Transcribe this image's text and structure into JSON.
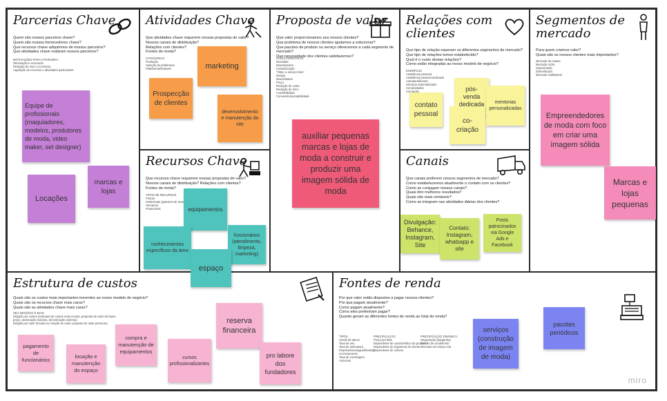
{
  "blocks": {
    "parcerias": {
      "title": "Parcerias Chave",
      "questions": "Quem são nossos parceiros chave?\nQuem são nossos fornecedores chave?\nQue recursos chave adquirimos de nossos parceiros?\nQue atividades chave realizam nossos parceiros?",
      "small": "MOTIVAÇÕES PARA A PARCERIA\nOtimização e economia\nRedução de risco e incerteza\nAquisição de recursos e atividades particulares",
      "notes": [
        "Equipe de profissionais (maquiadores, modelos, produtores de moda, video maker, set designer)",
        "Locações",
        "marcas e lojas"
      ]
    },
    "atividades": {
      "title": "Atividades Chave",
      "questions": "Que atividades chave requerem nossas propostas de valor?\nNossos canais de distribuição?\nRelações com clientes?\nFontes de renda?",
      "small": "CATEGORIAS\nProdução\nSolução de problemas\nPlataforma/Network",
      "notes": [
        "marketing",
        "Prospecção de clientes",
        "desenvolvimento e manutenção do site"
      ]
    },
    "recursos": {
      "title": "Recursos Chave",
      "questions": "Que recursos chave requerem nossas propostas de valor?\nNossos canais de distribuição? Relações com clientes?\nFontes de renda?",
      "small": "TIPOS DE RECURSOS\nFísicos\nIntelectuais (patentes de marcas, direitos autorais, dados)\nHumanos\nFinanceiros",
      "notes": [
        "equipamentos",
        "conhecimentos específicos da área",
        "funcionários (atendimento, limpeza, marketing)",
        "espaço"
      ]
    },
    "proposta": {
      "title": "Proposta de valor",
      "questions": "Que valor proporcionamos aos nossos clientes?\nQue problema de nossos clientes ajudamos a solucionar?\nQue pacotes de produto ou serviço oferecemos a cada segmento de mercado?\nQue necessidade dos clientes satisfazemos?",
      "small": "CARACTERÍSTICAS\nNovidade\nDesempenho\nCustomização\n\"Obter o serviço feito\"\nDesign\nMarca/status\nPreço\nRedução de custo\nRedução de risco\nAcessibilidade\nConveniência/usabilidade",
      "notes": [
        "auxiliar pequenas marcas e lojas de moda a construir e produzir uma imagem sólida de moda"
      ]
    },
    "relacoes": {
      "title": "Relações com\nclientes",
      "questions": "Que tipo de relação esperam os diferentes segmentos de mercado?\nQue tipo de relações temos estabelecido?\nQual é o custo destas relações?\nComo estão integradas ao nosso modelo de negócio?",
      "small": "EXEMPLOS\nAssistência pessoal\nAssistência pessoal dedicada\nAutoatendimento\nServiços automatizados\nComunidades\nCocriação",
      "notes": [
        "contato pessoal",
        "pós-venda dedicada",
        "co-criação",
        "mentorias personalizadas"
      ]
    },
    "canais": {
      "title": "Canais",
      "questions": "Que canais preferem nossos segmentos de mercado?\nComo estabelecemos atualmente o contato com os clientes?\nComo se conjugam nossos canais?\nQuais têm melhores resultados?\nQuais são mais rentáveis?\nComo se integram nas atividades diárias dos clientes?",
      "notes": [
        "Divulgação: Behance, Instagram, Site",
        "Contato: Instagram, whatsapp e site",
        "Posts patrocinados via Google Ads e Facebook"
      ]
    },
    "segmentos": {
      "title": "Segmentos de\nmercado",
      "questions": "Para quem criamos valor?\nQuais são os nossos clientes mais importantes?",
      "small": "Mercado de massa\nMercado nicho\nSegmentado\nDiversificado\nMercado multilateral",
      "notes": [
        "Empreendedores de moda com foco em criar uma imagem sólida",
        "Marcas e lojas pequenas"
      ]
    },
    "custos": {
      "title": "Estrutura de custos",
      "questions": "Quais são os custos mais importantes inerentes ao nosso modelo de negócio?\nQuais são os recursos chave mais caros?\nQuais são as atividades chave mais caras?",
      "small": "SEU NEGÓCIO É MAIS\nDirigido por custos (estrutura de custos mais enxuta, proposta de valor de baixo preço, automação máxima, terceirização extensa)\nDirigido por valor (focado na criação de valor, proposta de valor premium)",
      "notes": [
        "pagamento de funcionários",
        "locação e manutenção do espaço",
        "compra e manutenção de equipamentos",
        "cursos profissionalizantes",
        "reserva financeira",
        "pro labore dos fundadores"
      ]
    },
    "fontes": {
      "title": "Fontes de renda",
      "questions": "Por que valor estão dispostos a pagar nossos clientes?\nPor que pagam atualmente?\nComo pagam atualmente?\nComo eles prefeririam pagar?\nQuanto geram as diferentes fontes de renda ao total de renda?",
      "small1": "TIPOS\nVenda de ativos\nTaxa de uso\nTaxa de assinatura\nEmpréstimo/aluguel/leasing\nLicenciamento\nTaxa de corretagem\nAnúncios",
      "small2": "PRECIFICAÇÃO:\nPreço por lista\nDependente de característica do produto\nDependente do segmento de cliente\nDependente de volume",
      "small3": "PRECIFICAÇÃO DINÂMICA:\nNegociação (barganha)\nGestão de rendimento\nMercado em tempo real",
      "notes": [
        "serviços (construção de imagem de moda)",
        "pacotes periódicos"
      ]
    }
  },
  "logo": "miro",
  "colors": {
    "purple": "#c47fd6",
    "orange": "#f79d4a",
    "teal": "#4fc4bd",
    "pink": "#f58bb9",
    "red": "#ee5a78",
    "yellow": "#f9f49a",
    "green": "#cde46a",
    "light_pink": "#f7b3d2",
    "blue": "#7c84f2"
  },
  "icons": [
    "chain-links-icon",
    "worker-icon",
    "forklift-worker-icon",
    "gift-box-icon",
    "heart-icon",
    "delivery-truck-icon",
    "person-standing-icon",
    "receipt-icon",
    "cash-register-icon"
  ]
}
